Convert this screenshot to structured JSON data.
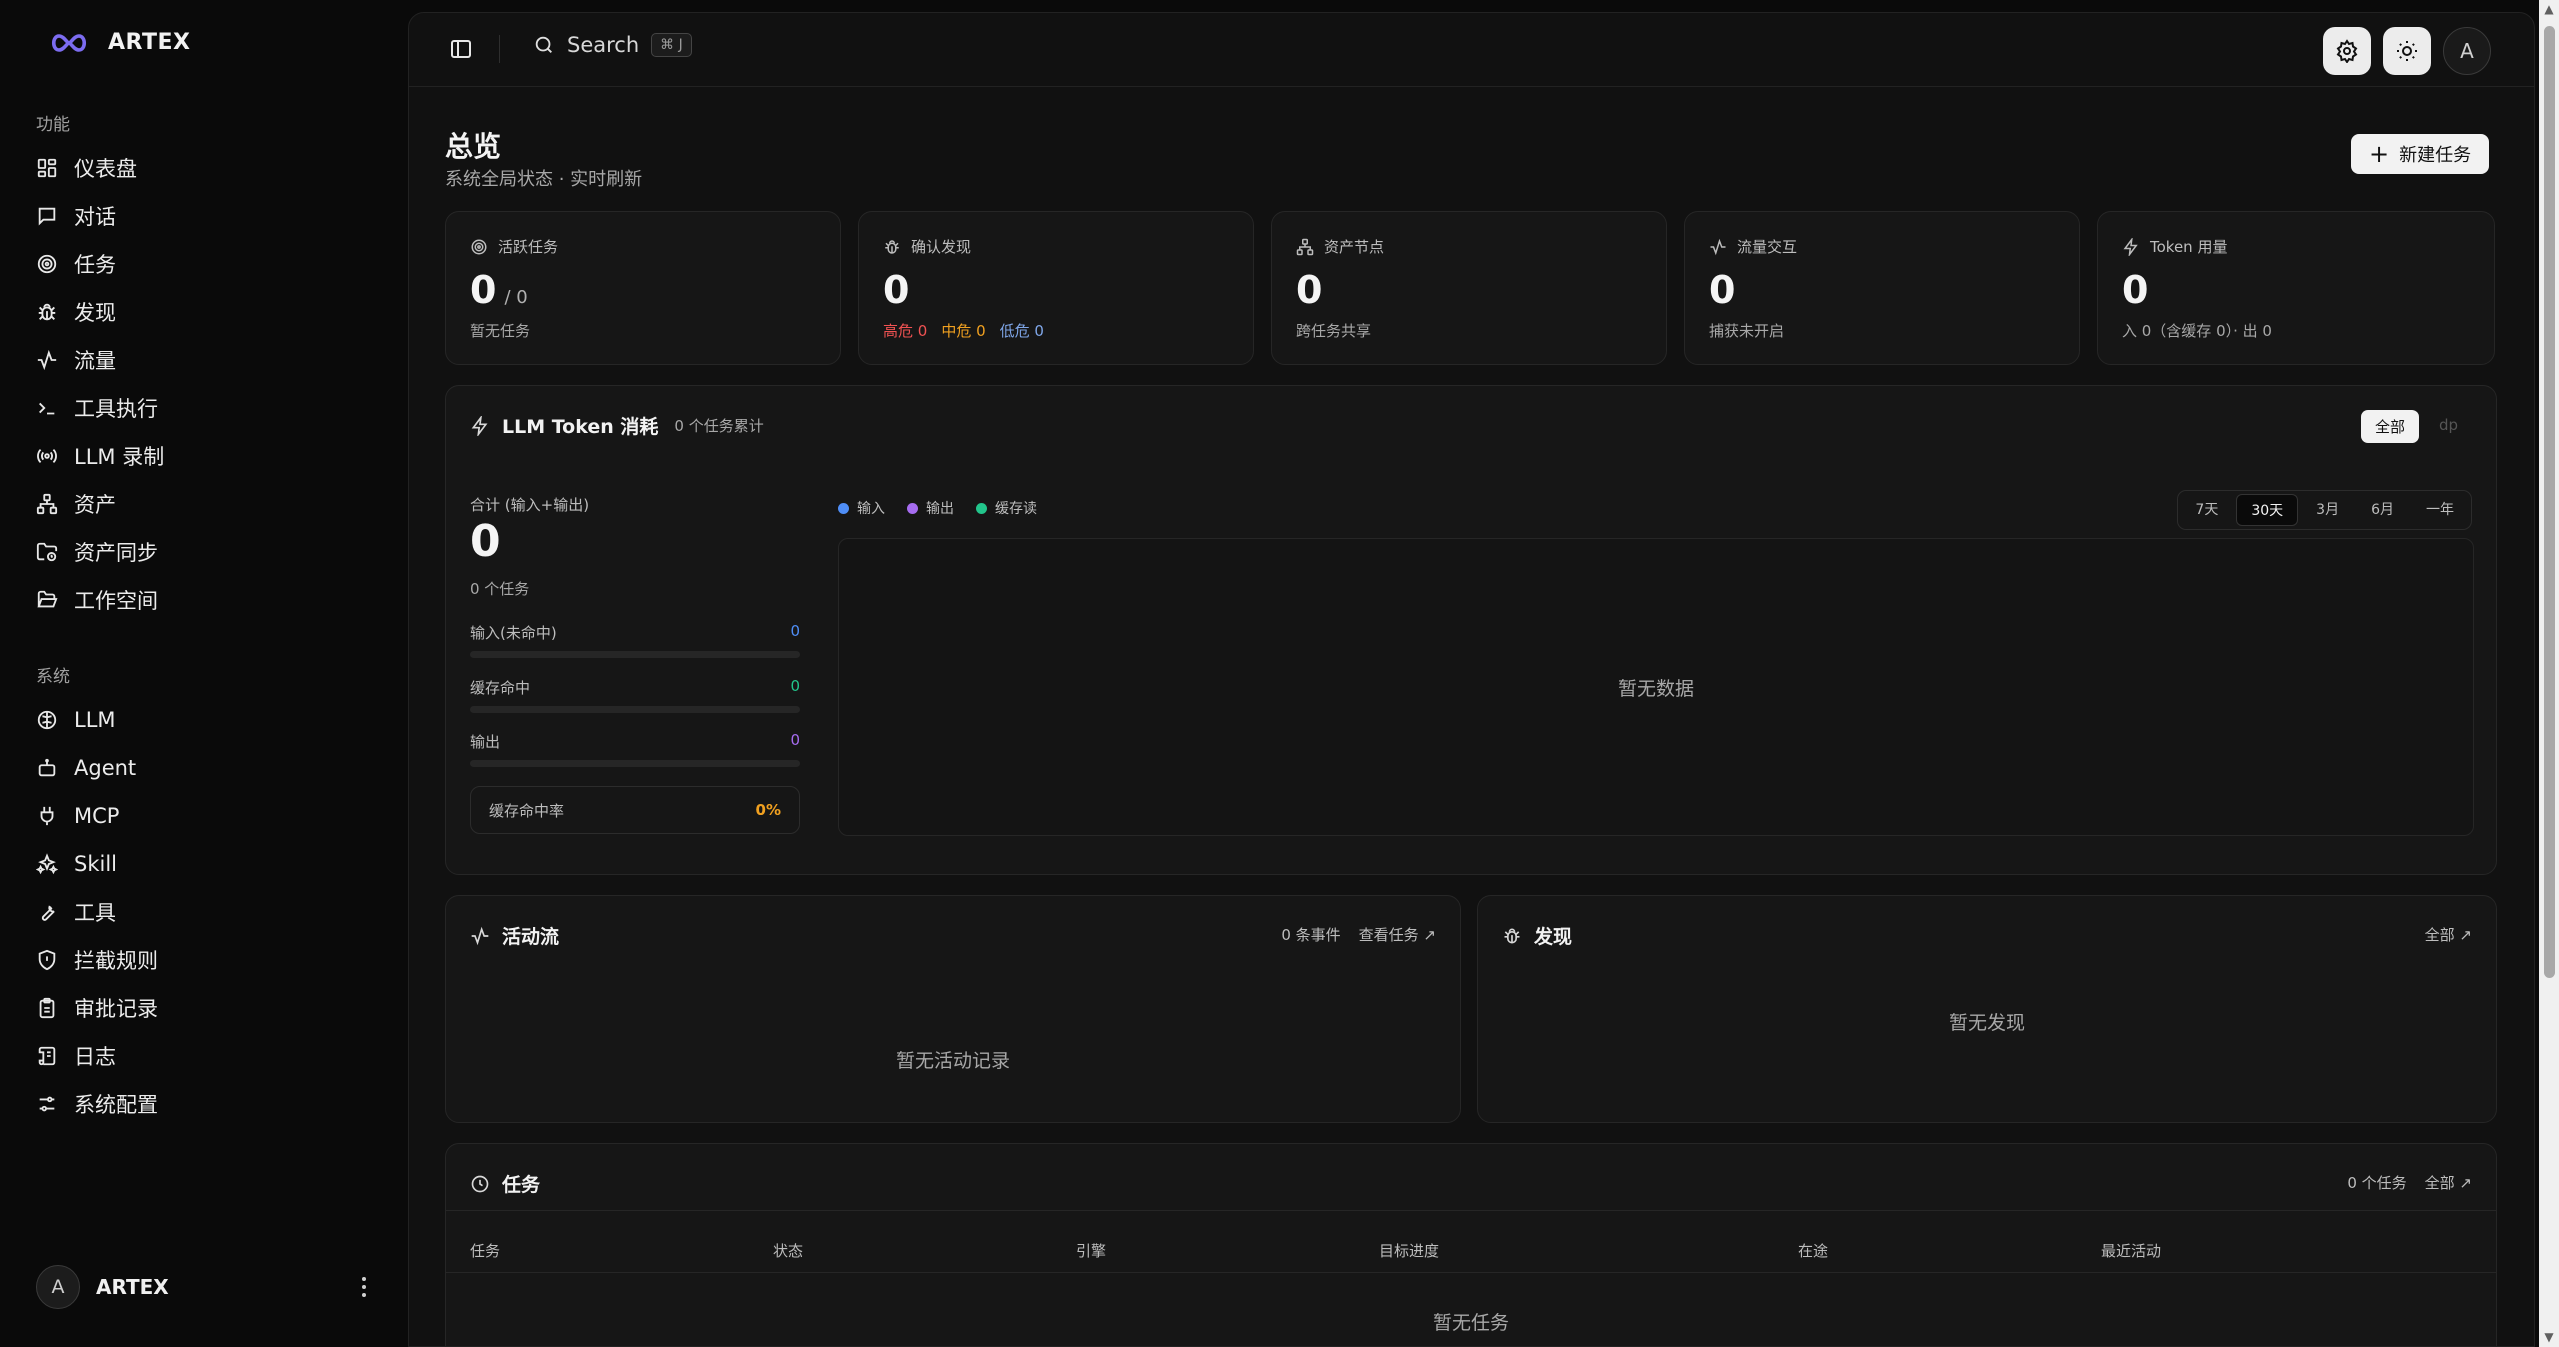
{
  "brand": {
    "name": "ARTEX"
  },
  "sidebar": {
    "section_features": "功能",
    "section_system": "系统",
    "features": [
      {
        "label": "仪表盘",
        "icon": "dashboard-icon"
      },
      {
        "label": "对话",
        "icon": "chat-icon"
      },
      {
        "label": "任务",
        "icon": "target-icon"
      },
      {
        "label": "发现",
        "icon": "bug-icon"
      },
      {
        "label": "流量",
        "icon": "activity-icon"
      },
      {
        "label": "工具执行",
        "icon": "terminal-icon"
      },
      {
        "label": "LLM 录制",
        "icon": "broadcast-icon"
      },
      {
        "label": "资产",
        "icon": "network-icon"
      },
      {
        "label": "资产同步",
        "icon": "folder-sync-icon"
      },
      {
        "label": "工作空间",
        "icon": "folder-open-icon"
      }
    ],
    "system": [
      {
        "label": "LLM",
        "icon": "brain-icon"
      },
      {
        "label": "Agent",
        "icon": "bot-icon"
      },
      {
        "label": "MCP",
        "icon": "plug-icon"
      },
      {
        "label": "Skill",
        "icon": "sparkles-icon"
      },
      {
        "label": "工具",
        "icon": "wrench-icon"
      },
      {
        "label": "拦截规则",
        "icon": "shield-icon"
      },
      {
        "label": "审批记录",
        "icon": "clipboard-icon"
      },
      {
        "label": "日志",
        "icon": "scroll-icon"
      },
      {
        "label": "系统配置",
        "icon": "sliders-icon"
      }
    ],
    "user": {
      "avatar": "A",
      "name": "ARTEX"
    }
  },
  "topbar": {
    "search_label": "Search",
    "search_shortcut": "⌘ J",
    "avatar": "A"
  },
  "header": {
    "title": "总览",
    "subtitle": "系统全局状态 · 实时刷新",
    "new_task": "新建任务"
  },
  "stats": [
    {
      "label": "活跃任务",
      "value": "0",
      "suffix": "/ 0",
      "foot": "暂无任务"
    },
    {
      "label": "确认发现",
      "value": "0",
      "foot_high": "高危 0",
      "foot_mid": "中危 0",
      "foot_low": "低危 0"
    },
    {
      "label": "资产节点",
      "value": "0",
      "foot": "跨任务共享"
    },
    {
      "label": "流量交互",
      "value": "0",
      "foot": "捕获未开启"
    },
    {
      "label": "Token 用量",
      "value": "0",
      "foot": "入 0（含缓存 0）· 出 0"
    }
  ],
  "token": {
    "title": "LLM Token 消耗",
    "subtitle": "0 个任务累计",
    "scope_all": "全部",
    "scope_dp": "dp",
    "sum_label": "合计 (输入+输出)",
    "sum_value": "0",
    "sum_tasks": "0 个任务",
    "meters": [
      {
        "label": "输入(未命中)",
        "value": "0",
        "color": "#4f8ef7",
        "fill": 0
      },
      {
        "label": "缓存命中",
        "value": "0",
        "color": "#22c58b",
        "fill": 0
      },
      {
        "label": "输出",
        "value": "0",
        "color": "#a66cf0",
        "fill": 0
      }
    ],
    "hit_rate_label": "缓存命中率",
    "hit_rate_value": "0%",
    "legend": [
      {
        "label": "输入",
        "color": "#4f8ef7"
      },
      {
        "label": "输出",
        "color": "#a66cf0"
      },
      {
        "label": "缓存读",
        "color": "#22c58b"
      }
    ],
    "ranges": [
      "7天",
      "30天",
      "3月",
      "6月",
      "一年"
    ],
    "active_range": "30天",
    "empty": "暂无数据"
  },
  "activity": {
    "title": "活动流",
    "count": "0 条事件",
    "link": "查看任务 ↗",
    "empty": "暂无活动记录"
  },
  "findings": {
    "title": "发现",
    "link": "全部 ↗",
    "empty": "暂无发现"
  },
  "tasks": {
    "title": "任务",
    "count": "0 个任务",
    "link": "全部 ↗",
    "columns": [
      "任务",
      "状态",
      "引擎",
      "目标进度",
      "在途",
      "最近活动"
    ],
    "empty": "暂无任务"
  }
}
